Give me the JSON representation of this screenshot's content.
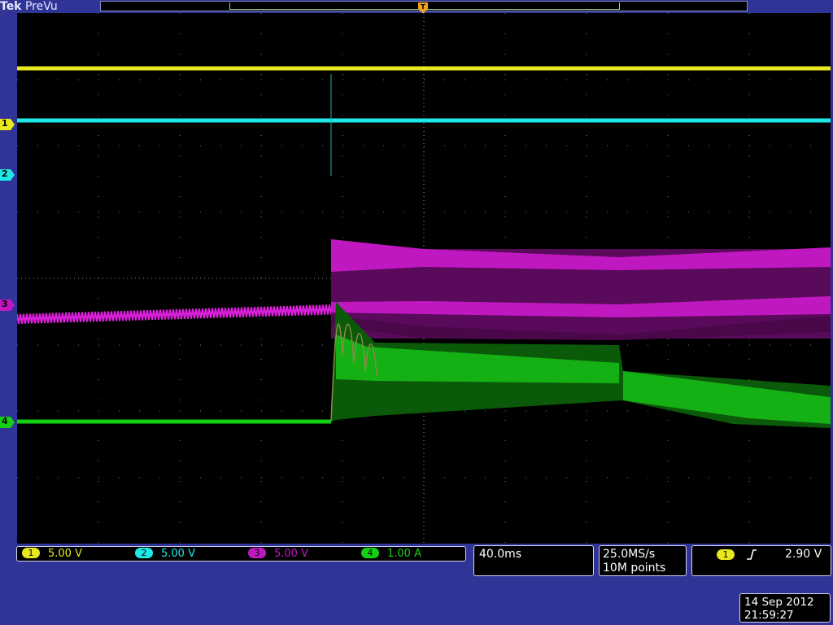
{
  "header": {
    "brand": "Tek",
    "mode": "PreVu"
  },
  "channels": [
    {
      "id": "1",
      "scale": "5.00 V",
      "color": "#e8e81c"
    },
    {
      "id": "2",
      "scale": "5.00 V",
      "color": "#1ee8e8"
    },
    {
      "id": "3",
      "scale": "5.00 V",
      "color": "#d010d0"
    },
    {
      "id": "4",
      "scale": "1.00 A",
      "color": "#14d014"
    }
  ],
  "timebase": "40.0ms",
  "acquisition": {
    "sample_rate": "25.0MS/s",
    "record_length": "10M points"
  },
  "trigger": {
    "source": "1",
    "slope_icon": "rising-edge-icon",
    "level": "2.90 V"
  },
  "datetime": {
    "date": "14 Sep 2012",
    "time": "21:59:27"
  },
  "display": {
    "background": "#000000",
    "frame_color": "#2f3496",
    "graticule_divisions": [
      10,
      8
    ]
  }
}
